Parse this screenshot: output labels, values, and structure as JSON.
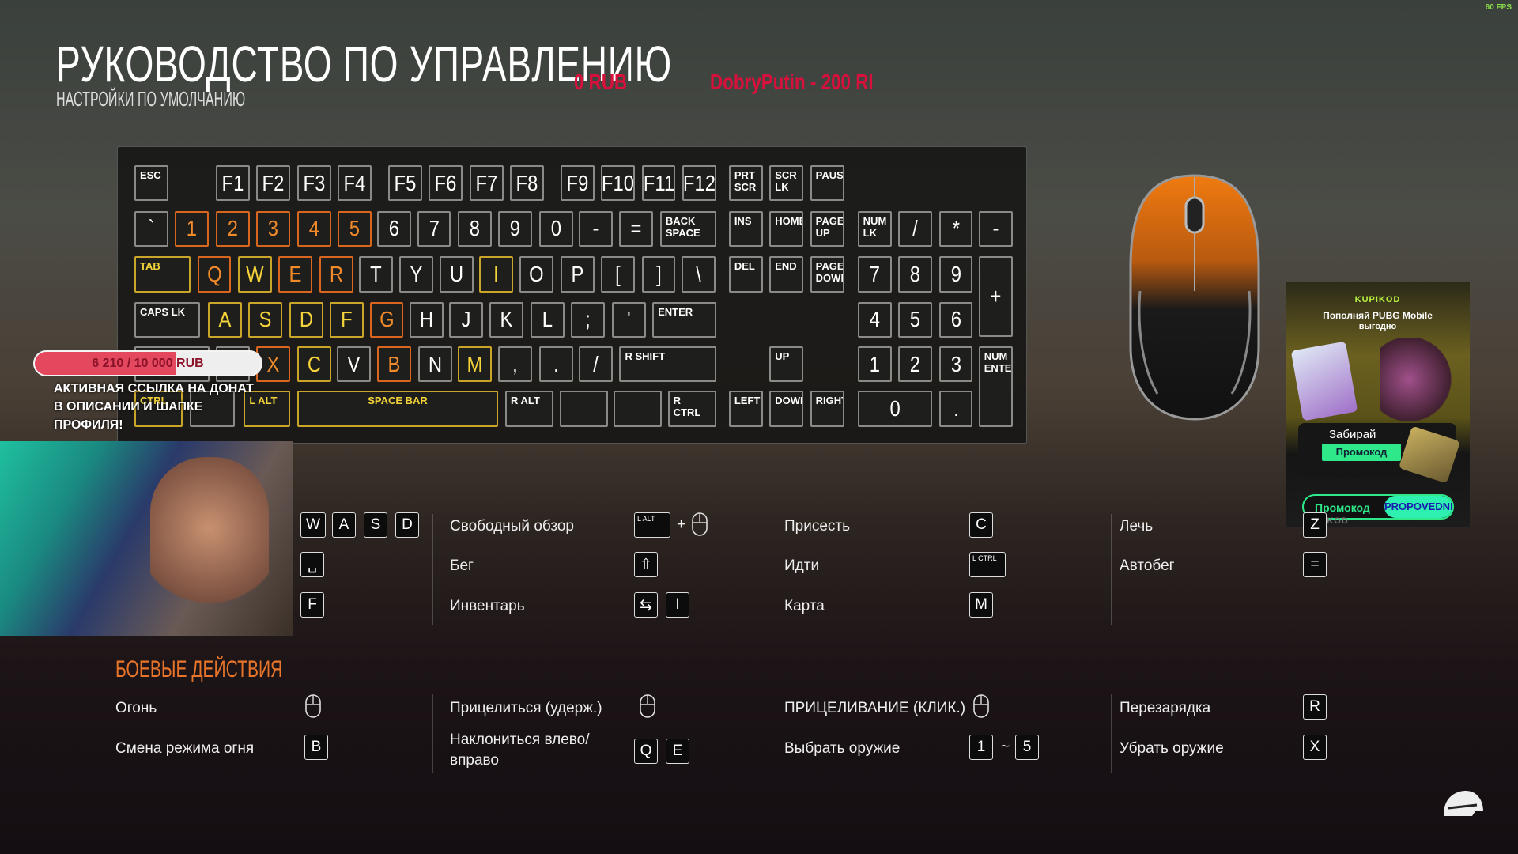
{
  "fps": "60 FPS",
  "header": {
    "title": "РУКОВОДСТВО ПО УПРАВЛЕНИЮ",
    "subtitle": "НАСТРОЙКИ ПО УМОЛЧАНИЮ"
  },
  "ticker": {
    "item1": "0 RUB",
    "item2": "DobryPutin - 200 RI"
  },
  "colors": {
    "orange": "#f08a2a",
    "yellow": "#f4d43a",
    "accent_red": "#d8103c",
    "donation_fill": "#e4485e",
    "promo_green": "#2ee88a"
  },
  "donation": {
    "text": "6 210 / 10 000 RUB",
    "current": 6210,
    "goal": 10000,
    "note": "АКТИВНАЯ ССЫЛКА НА ДОНАТ В ОПИСАНИИ И ШАПКЕ ПРОФИЛЯ!"
  },
  "keyboard": {
    "rows": [
      [
        {
          "l": "ESC"
        },
        {
          "l": "F1"
        },
        {
          "l": "F2"
        },
        {
          "l": "F3"
        },
        {
          "l": "F4"
        },
        {
          "l": "F5"
        },
        {
          "l": "F6"
        },
        {
          "l": "F7"
        },
        {
          "l": "F8"
        },
        {
          "l": "F9"
        },
        {
          "l": "F10"
        },
        {
          "l": "F11"
        },
        {
          "l": "F12"
        },
        {
          "l": "PRT\nSCR"
        },
        {
          "l": "SCR\nLK"
        },
        {
          "l": "PAUSE"
        }
      ],
      [
        {
          "l": "`"
        },
        {
          "l": "1",
          "c": "orange"
        },
        {
          "l": "2",
          "c": "orange"
        },
        {
          "l": "3",
          "c": "orange"
        },
        {
          "l": "4",
          "c": "orange"
        },
        {
          "l": "5",
          "c": "orange"
        },
        {
          "l": "6"
        },
        {
          "l": "7"
        },
        {
          "l": "8"
        },
        {
          "l": "9"
        },
        {
          "l": "0"
        },
        {
          "l": "-"
        },
        {
          "l": "="
        },
        {
          "l": "BACK\nSPACE"
        },
        {
          "l": "INS"
        },
        {
          "l": "HOME"
        },
        {
          "l": "PAGE\nUP"
        },
        {
          "l": "NUM\nLK"
        },
        {
          "l": "/"
        },
        {
          "l": "*"
        },
        {
          "l": "-"
        }
      ],
      [
        {
          "l": "TAB",
          "c": "yellow"
        },
        {
          "l": "Q",
          "c": "orange"
        },
        {
          "l": "W",
          "c": "yellow"
        },
        {
          "l": "E",
          "c": "orange"
        },
        {
          "l": "R",
          "c": "orange"
        },
        {
          "l": "T"
        },
        {
          "l": "Y"
        },
        {
          "l": "U"
        },
        {
          "l": "I",
          "c": "yellow"
        },
        {
          "l": "O"
        },
        {
          "l": "P"
        },
        {
          "l": "["
        },
        {
          "l": "]"
        },
        {
          "l": "\\"
        },
        {
          "l": "DEL"
        },
        {
          "l": "END"
        },
        {
          "l": "PAGE\nDOWN"
        },
        {
          "l": "7"
        },
        {
          "l": "8"
        },
        {
          "l": "9"
        },
        {
          "l": "+"
        }
      ],
      [
        {
          "l": "CAPS LK"
        },
        {
          "l": "A",
          "c": "yellow"
        },
        {
          "l": "S",
          "c": "yellow"
        },
        {
          "l": "D",
          "c": "yellow"
        },
        {
          "l": "F",
          "c": "yellow"
        },
        {
          "l": "G",
          "c": "orange"
        },
        {
          "l": "H"
        },
        {
          "l": "J"
        },
        {
          "l": "K"
        },
        {
          "l": "L"
        },
        {
          "l": ";"
        },
        {
          "l": "'"
        },
        {
          "l": "ENTER"
        },
        {
          "l": "4"
        },
        {
          "l": "5"
        },
        {
          "l": "6"
        }
      ],
      [
        {
          "l": ""
        },
        {
          "l": ""
        },
        {
          "l": "X",
          "c": "orange"
        },
        {
          "l": "C",
          "c": "yellow"
        },
        {
          "l": "V"
        },
        {
          "l": "B",
          "c": "orange"
        },
        {
          "l": "N"
        },
        {
          "l": "M",
          "c": "yellow"
        },
        {
          "l": ","
        },
        {
          "l": "."
        },
        {
          "l": "/"
        },
        {
          "l": "R SHIFT"
        },
        {
          "l": "UP"
        },
        {
          "l": "1"
        },
        {
          "l": "2"
        },
        {
          "l": "3"
        },
        {
          "l": "NUM\nENTER"
        }
      ],
      [
        {
          "l": "CTRL",
          "c": "yellow"
        },
        {
          "l": ""
        },
        {
          "l": "L ALT",
          "c": "yellow"
        },
        {
          "l": "SPACE BAR",
          "c": "yellow"
        },
        {
          "l": "R ALT"
        },
        {
          "l": ""
        },
        {
          "l": ""
        },
        {
          "l": "R CTRL"
        },
        {
          "l": "LEFT"
        },
        {
          "l": "DOWN"
        },
        {
          "l": "RIGHT"
        },
        {
          "l": "0"
        },
        {
          "l": "."
        }
      ]
    ]
  },
  "ad": {
    "brand": "KUPIKOD",
    "headline": "Пополняй PUBG Mobile",
    "headline2": "выгодно",
    "cta": "Забирай",
    "cta_button": "Промокод",
    "promo_label": "Промокод",
    "promo_code": "PROPOVEDNIK",
    "footer": "KUPIKOD"
  },
  "movement": [
    {
      "keys": [
        "W",
        "A",
        "S",
        "D"
      ],
      "label": "Свободный обзор",
      "keys2": [
        "L ALT",
        "+",
        "mouse"
      ],
      "label3": "Присесть",
      "keys3": [
        "C"
      ],
      "label4": "Лечь",
      "keys4": [
        "Z"
      ]
    },
    {
      "keys": [
        "␣"
      ],
      "label": "Бег",
      "keys2": [
        "⇧"
      ],
      "label3": "Идти",
      "keys3": [
        "L CTRL"
      ],
      "label4": "Автобег",
      "keys4": [
        "="
      ]
    },
    {
      "keys": [
        "F"
      ],
      "label": "Инвентарь",
      "keys2": [
        "⇆",
        "I"
      ],
      "label3": "Карта",
      "keys3": [
        "M"
      ],
      "label4": "",
      "keys4": []
    }
  ],
  "combat": {
    "title": "БОЕВЫЕ ДЕЙСТВИЯ",
    "rows": [
      {
        "l1": "Огонь",
        "k1": [
          "mouse"
        ],
        "l2": "Прицелиться (удерж.)",
        "k2": [
          "mouse"
        ],
        "l3": "ПРИЦЕЛИВАНИЕ (КЛИК.)",
        "k3": [
          "mouse"
        ],
        "l4": "Перезарядка",
        "k4": [
          "R"
        ]
      },
      {
        "l1": "Смена режима огня",
        "k1": [
          "B"
        ],
        "l2": "Наклониться влево/\nвправо",
        "k2": [
          "Q",
          "E"
        ],
        "l3": "Выбрать оружие",
        "k3": [
          "1",
          "~",
          "5"
        ],
        "l4": "Убрать оружие",
        "k4": [
          "X"
        ]
      }
    ]
  }
}
